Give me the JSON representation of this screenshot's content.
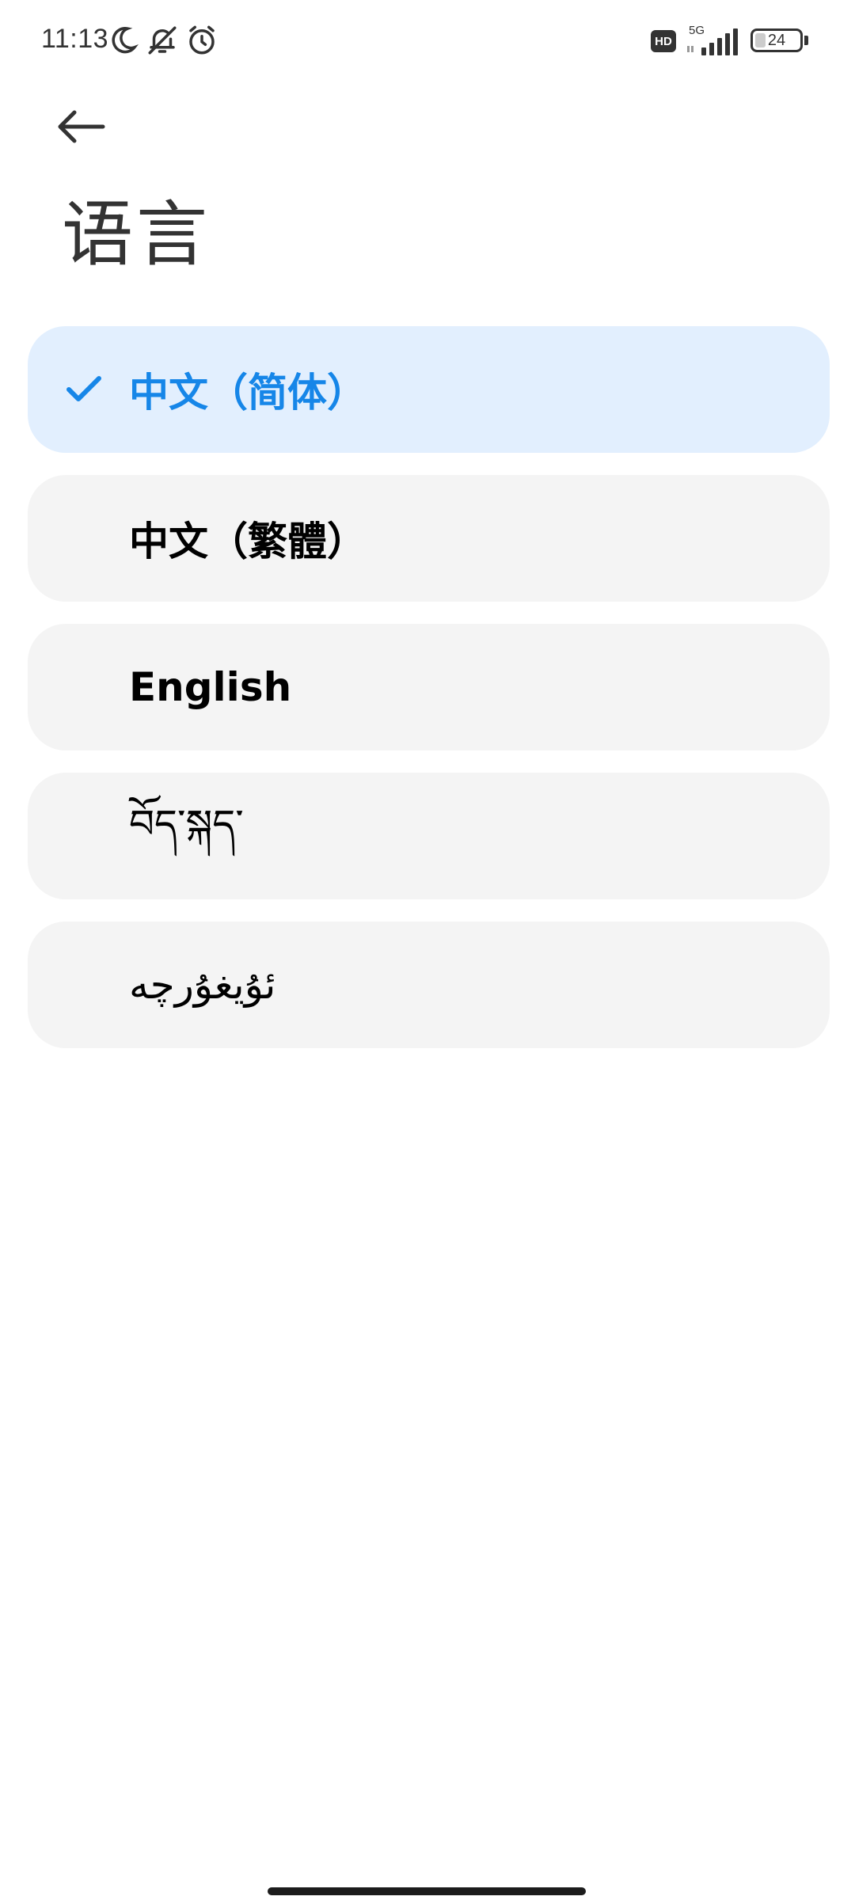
{
  "status_bar": {
    "time": "11:13",
    "hd_badge": "HD",
    "network": "5G",
    "battery_level": "24",
    "battery_fraction": 0.24,
    "icons": [
      "moon-icon",
      "bell-off-icon",
      "alarm-icon",
      "signal-icon",
      "battery-icon"
    ]
  },
  "header": {
    "back_icon": "arrow-left-icon",
    "title": "语言"
  },
  "languages": [
    {
      "label": "中文（简体）",
      "selected": true
    },
    {
      "label": "中文（繁體）",
      "selected": false
    },
    {
      "label": "English",
      "selected": false
    },
    {
      "label": "བོད་སྐད་",
      "selected": false
    },
    {
      "label": "ئۇيغۇرچە",
      "selected": false
    }
  ],
  "colors": {
    "accent": "#1686e8",
    "selected_bg": "#e2effe",
    "item_bg": "#f4f4f4",
    "text": "#000000",
    "title": "#333333"
  }
}
